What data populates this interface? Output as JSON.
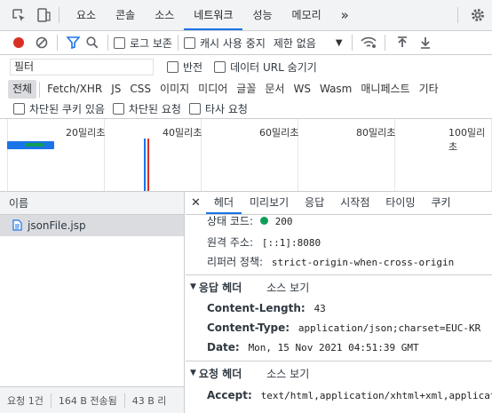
{
  "devtools": {
    "tabs": [
      "요소",
      "콘솔",
      "소스",
      "네트워크",
      "성능",
      "메모리"
    ],
    "active_tab": "네트워크",
    "more_tabs": "»"
  },
  "toolbar": {
    "preserve_log": "로그 보존",
    "disable_cache": "캐시 사용 중지",
    "throttling": "제한 없음"
  },
  "filter": {
    "placeholder": "필터",
    "invert": "반전",
    "hide_data_urls": "데이터 URL 숨기기"
  },
  "types": [
    "전체",
    "Fetch/XHR",
    "JS",
    "CSS",
    "이미지",
    "미디어",
    "글꼴",
    "문서",
    "WS",
    "Wasm",
    "매니페스트",
    "기타"
  ],
  "type_active": "전체",
  "cookies": {
    "blocked_cookies": "차단된 쿠키 있음",
    "blocked_requests": "차단된 요청",
    "third_party": "타사 요청"
  },
  "timeline": {
    "ticks": [
      "20밀리초",
      "40밀리초",
      "60밀리초",
      "80밀리초",
      "100밀리초"
    ]
  },
  "requests": {
    "header": "이름",
    "items": [
      {
        "name": "jsonFile.jsp"
      }
    ],
    "status": {
      "count": "요청 1건",
      "transferred": "164 B 전송됨",
      "resources": "43 B 리"
    }
  },
  "details": {
    "tabs": [
      "헤더",
      "미리보기",
      "응답",
      "시작점",
      "타이밍",
      "쿠키"
    ],
    "active_tab": "헤더",
    "general": [
      {
        "key": "상태 코드:",
        "value": "200"
      },
      {
        "key": "원격 주소:",
        "value": "[::1]:8080"
      },
      {
        "key": "리퍼러 정책:",
        "value": "strict-origin-when-cross-origin"
      }
    ],
    "response_headers": {
      "title": "응답 헤더",
      "view_source": "소스 보기",
      "items": [
        {
          "key": "Content-Length:",
          "value": "43"
        },
        {
          "key": "Content-Type:",
          "value": "application/json;charset=EUC-KR"
        },
        {
          "key": "Date:",
          "value": "Mon, 15 Nov 2021 04:51:39 GMT"
        }
      ]
    },
    "request_headers": {
      "title": "요청 헤더",
      "view_source": "소스 보기",
      "items": [
        {
          "key": "Accept:",
          "value": "text/html,application/xhtml+xml,applicatio"
        }
      ]
    }
  },
  "colors": {
    "accent": "#1a73e8",
    "record": "#d93025",
    "status_ok": "#0f9d58"
  }
}
